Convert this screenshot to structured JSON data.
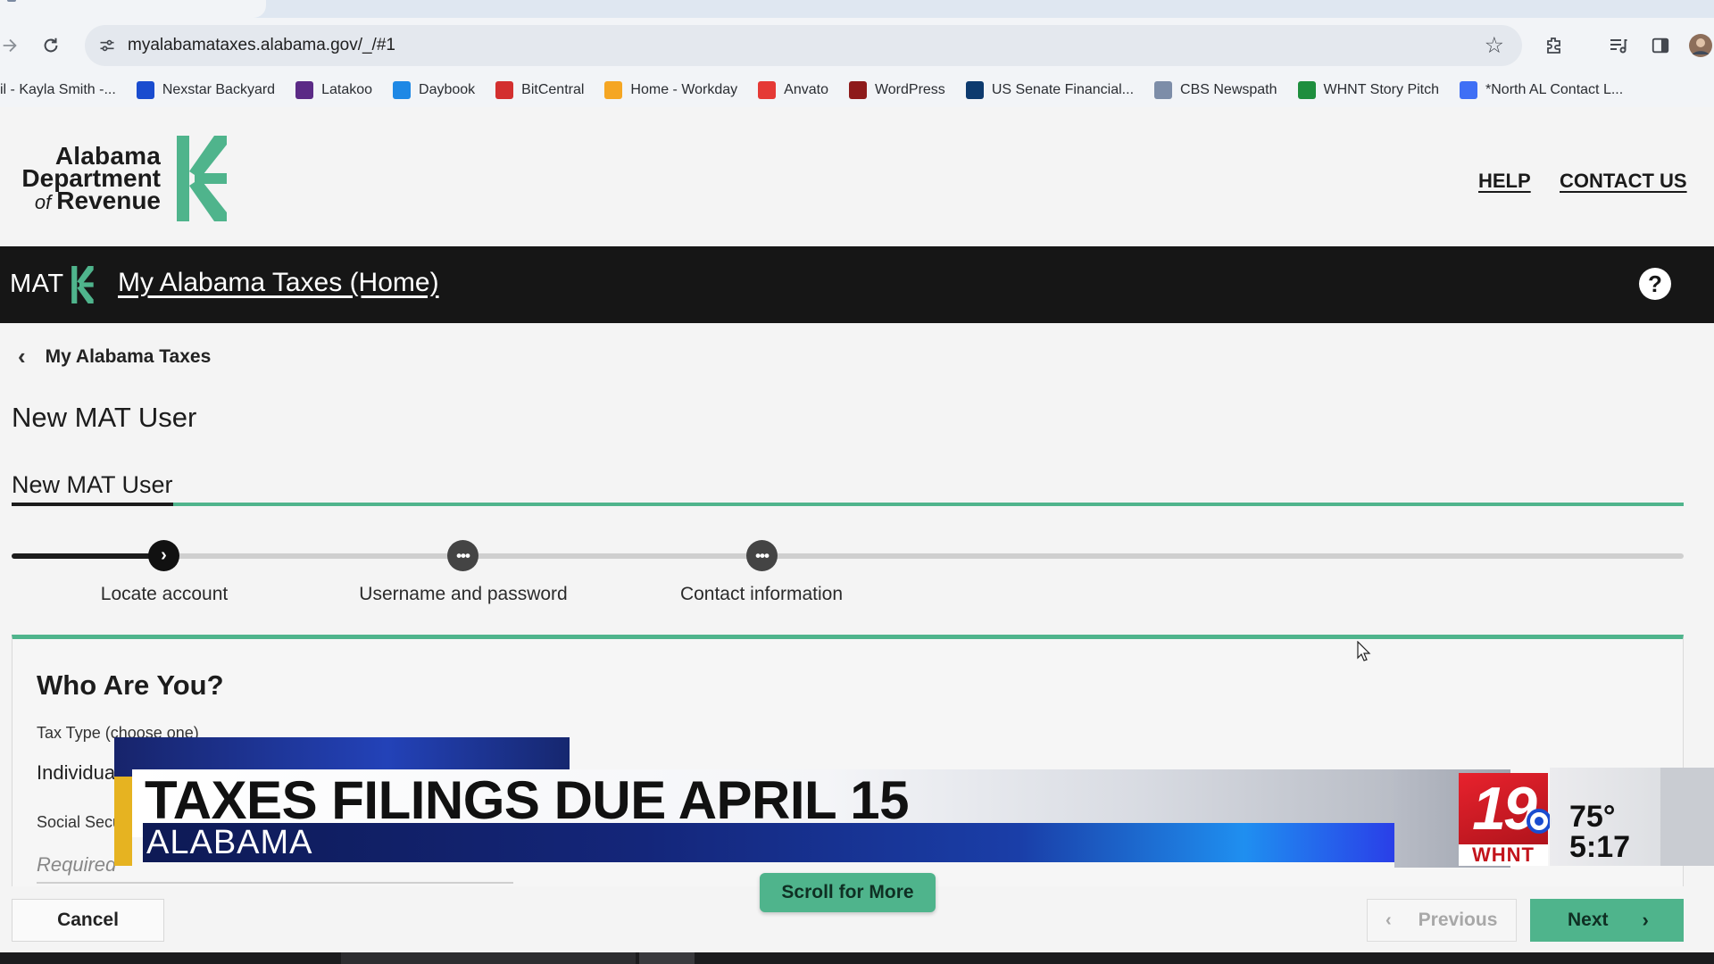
{
  "browser": {
    "url": "myalabamataxes.alabama.gov/_/#1",
    "bookmarks": [
      {
        "label": "il - Kayla Smith -...",
        "icon": "mail-icon",
        "color": "#c5221f"
      },
      {
        "label": "Nexstar Backyard",
        "icon": "nexstar-icon",
        "color": "#1a4ccf"
      },
      {
        "label": "Latakoo",
        "icon": "latakoo-icon",
        "color": "#5b2a86"
      },
      {
        "label": "Daybook",
        "icon": "daybook-icon",
        "color": "#1e88e5"
      },
      {
        "label": "BitCentral",
        "icon": "bitcentral-icon",
        "color": "#d32f2f"
      },
      {
        "label": "Home - Workday",
        "icon": "workday-icon",
        "color": "#f5a623"
      },
      {
        "label": "Anvato",
        "icon": "anvato-icon",
        "color": "#e53935"
      },
      {
        "label": "WordPress",
        "icon": "wordpress-icon",
        "color": "#8e1b1b"
      },
      {
        "label": "US Senate Financial...",
        "icon": "senate-icon",
        "color": "#0d3a6e"
      },
      {
        "label": "CBS Newspath",
        "icon": "cbs-icon",
        "color": "#7d8da8"
      },
      {
        "label": "WHNT Story Pitch",
        "icon": "sheets-icon",
        "color": "#1e8e3e"
      },
      {
        "label": "*North AL Contact L...",
        "icon": "docs-icon",
        "color": "#3f6ff5"
      }
    ]
  },
  "header": {
    "logo": {
      "line1": "Alabama",
      "line2": "Department",
      "line3_of": "of",
      "line3": "Revenue"
    },
    "help_link": "HELP",
    "contact_link": "CONTACT US",
    "accent_color": "#4fb48c"
  },
  "matbar": {
    "logo_text": "MAT",
    "home_link": "My Alabama Taxes (Home)",
    "help_icon": "?"
  },
  "page": {
    "back_label": "My Alabama Taxes",
    "title": "New MAT User",
    "subtitle": "New MAT User",
    "steps": [
      {
        "label": "Locate account",
        "state": "current"
      },
      {
        "label": "Username and password",
        "state": "pending"
      },
      {
        "label": "Contact information",
        "state": "pending"
      }
    ],
    "form": {
      "heading": "Who Are You?",
      "tax_type_label": "Tax Type (choose one)",
      "tax_type_value": "Individua",
      "ssn_label": "Social Secu",
      "ssn_placeholder": "Required"
    }
  },
  "buttons": {
    "scroll_more": "Scroll for More",
    "cancel": "Cancel",
    "previous": "Previous",
    "next": "Next"
  },
  "broadcast": {
    "headline": "TAXES FILINGS DUE APRIL 15",
    "location": "ALABAMA",
    "station_number": "19",
    "station_call": "WHNT",
    "temperature": "75°",
    "time": "5:17"
  }
}
